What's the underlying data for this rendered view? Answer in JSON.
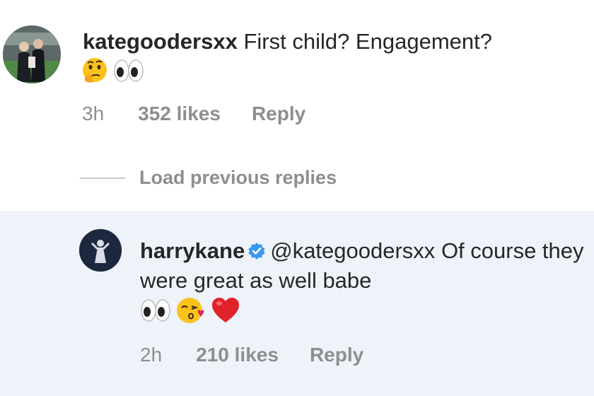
{
  "comments": [
    {
      "username": "kategoodersxx",
      "text": "First child? Engagement?",
      "emojis": [
        "thinking-face-emoji",
        "eyes-emoji"
      ],
      "time": "3h",
      "likes": "352 likes",
      "reply_label": "Reply"
    }
  ],
  "load_previous": "Load previous replies",
  "reply": {
    "username": "harrykane",
    "verified": true,
    "mention": "@kategoodersxx",
    "text_after_mention": "Of course they were great as well babe",
    "emojis": [
      "eyes-emoji",
      "face-blowing-kiss-emoji",
      "red-heart-emoji"
    ],
    "time": "2h",
    "likes": "210 likes",
    "reply_label": "Reply"
  },
  "colors": {
    "text": "#262626",
    "meta_text": "#8e8e8e",
    "reply_background": "#eef3fa",
    "verified_badge": "#3897f0"
  }
}
